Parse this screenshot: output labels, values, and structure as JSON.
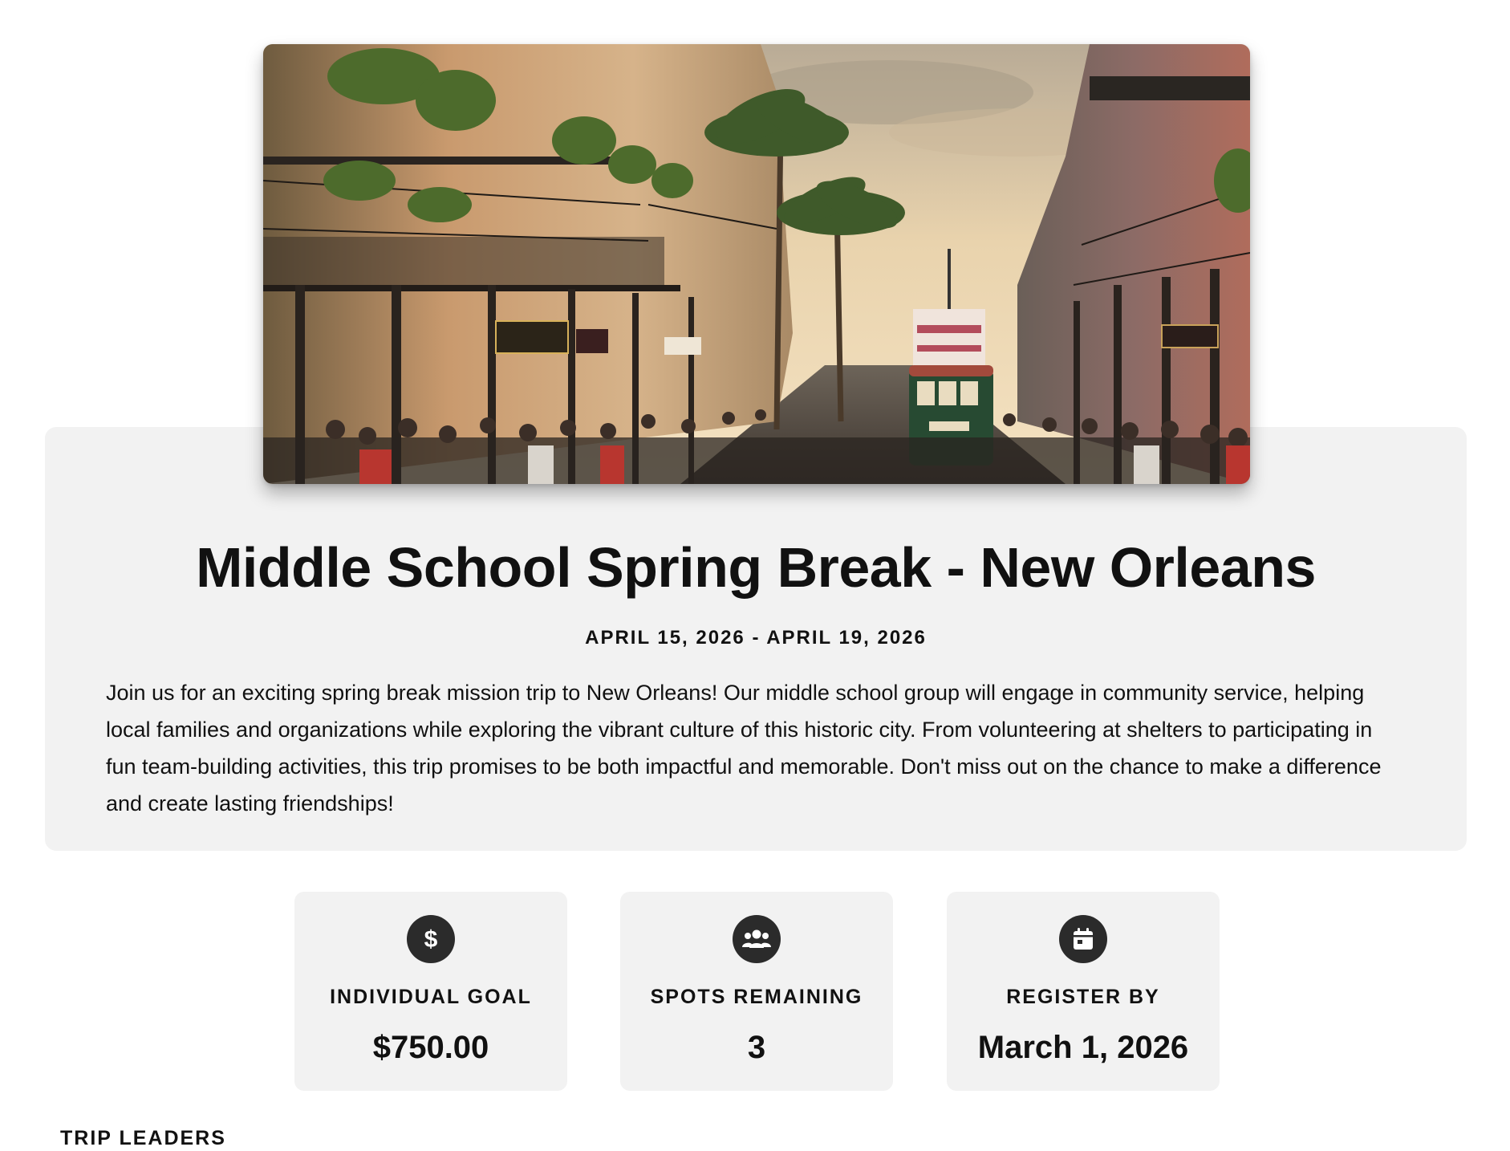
{
  "trip": {
    "hero_image_alt": "",
    "title": "Middle School Spring Break - New Orleans",
    "dates": "APRIL 15, 2026 - APRIL 19, 2026",
    "description": "Join us for an exciting spring break mission trip to New Orleans! Our middle school group will engage in community service, helping local families and organizations while exploring the vibrant culture of this historic city. From volunteering at shelters to participating in fun team-building activities, this trip promises to be both impactful and memorable. Don't miss out on the chance to make a difference and create lasting friendships!"
  },
  "stats": {
    "goal": {
      "icon": "dollar-icon",
      "label": "INDIVIDUAL GOAL",
      "value": "$750.00"
    },
    "spots": {
      "icon": "group-icon",
      "label": "SPOTS REMAINING",
      "value": "3"
    },
    "register": {
      "icon": "calendar-icon",
      "label": "REGISTER BY",
      "value": "March 1, 2026"
    }
  },
  "sections": {
    "trip_leaders": "TRIP LEADERS"
  },
  "colors": {
    "panel_bg": "#f2f2f2",
    "icon_bg": "#2b2b2b",
    "text": "#111111"
  }
}
